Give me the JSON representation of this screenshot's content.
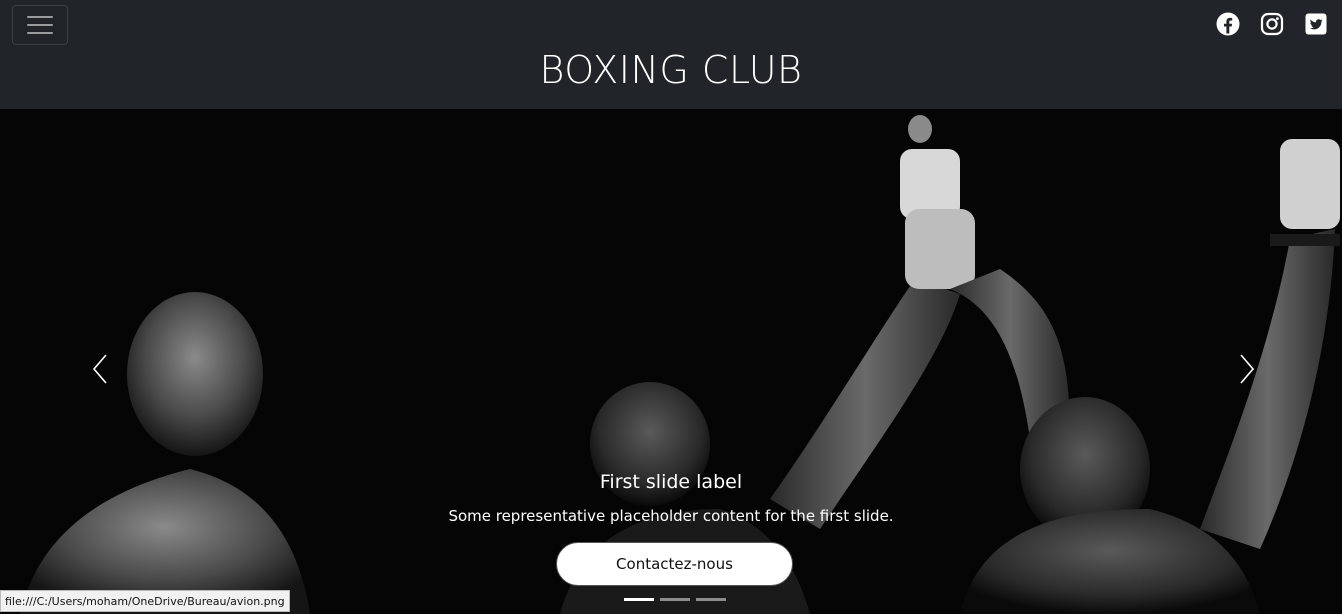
{
  "navbar": {
    "brand": "BOXING CLUB",
    "toggler_icon": "hamburger-icon",
    "social": [
      {
        "name": "facebook",
        "icon": "facebook-icon"
      },
      {
        "name": "instagram",
        "icon": "instagram-icon"
      },
      {
        "name": "twitter",
        "icon": "twitter-icon"
      }
    ]
  },
  "carousel": {
    "caption_title": "First slide label",
    "caption_text": "Some representative placeholder content for the first slide.",
    "cta_label": "Contactez-nous",
    "indicators_count": 3,
    "active_indicator": 0,
    "prev_icon": "chevron-left-icon",
    "next_icon": "chevron-right-icon"
  },
  "status_bar": {
    "url": "file:///C:/Users/moham/OneDrive/Bureau/avion.png"
  },
  "colors": {
    "navbar_bg": "#212529",
    "text": "#ffffff",
    "button_bg": "#ffffff"
  }
}
